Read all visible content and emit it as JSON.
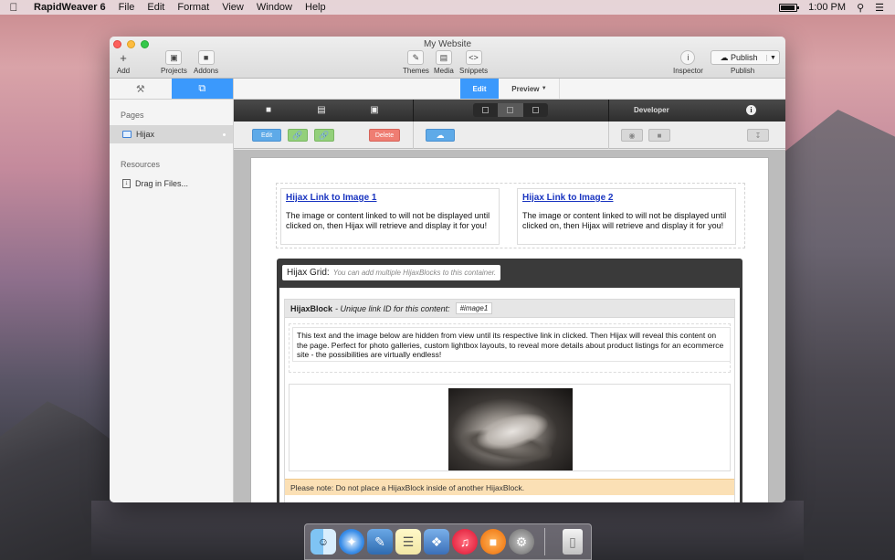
{
  "menubar": {
    "apple_icon": "apple-icon",
    "app_name": "RapidWeaver 6",
    "items": [
      "File",
      "Edit",
      "Format",
      "View",
      "Window",
      "Help"
    ],
    "clock": "1:00 PM"
  },
  "window": {
    "title": "My Website",
    "toolbar": {
      "add": "Add",
      "projects": "Projects",
      "addons": "Addons",
      "themes": "Themes",
      "media": "Media",
      "snippets": "Snippets",
      "inspector": "Inspector",
      "publish": "Publish",
      "publish_caption": "Publish"
    }
  },
  "sidebar": {
    "pages_heading": "Pages",
    "pages": [
      {
        "label": "Hijax"
      }
    ],
    "resources_heading": "Resources",
    "resources": [
      {
        "label": "Drag in Files..."
      }
    ]
  },
  "modes": {
    "edit": "Edit",
    "preview": "Preview"
  },
  "darkbar": {
    "developer": "Developer"
  },
  "buttons": {
    "edit": "Edit",
    "delete": "Delete"
  },
  "content": {
    "link1": {
      "title": "Hijax Link to Image 1",
      "text": "The image or content linked to will not be displayed until clicked on, then Hijax will retrieve and display it for you!"
    },
    "link2": {
      "title": "Hijax Link to Image 2",
      "text": "The image or content linked to will not be displayed until clicked on, then Hijax will retrieve and display it for you!"
    },
    "grid": {
      "label": "Hijax Grid:",
      "hint": "You can add multiple HijaxBlocks to this container."
    },
    "block": {
      "label": "HijaxBlock",
      "hint": "- Unique link ID for this content:",
      "id": "#image1",
      "text": "This text and the image below are hidden from view until its respective link in clicked. Then Hijax will reveal this content on the page. Perfect for photo galleries, custom lightbox layouts, to reveal more details about product listings for an ecommerce site - the possibilities are virtually endless!",
      "note": "Please note: Do not place a HijaxBlock inside of another HijaxBlock."
    }
  }
}
